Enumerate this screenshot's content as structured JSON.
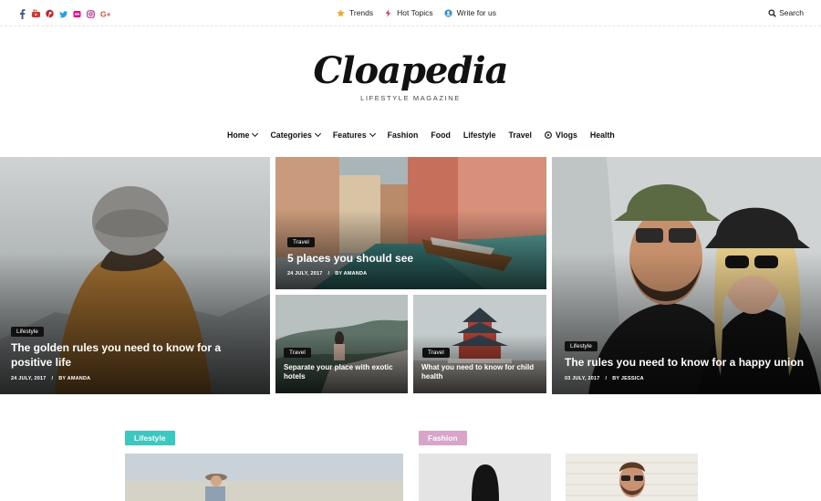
{
  "topbar": {
    "social": [
      {
        "icon": "facebook-icon",
        "color": "#3b5998"
      },
      {
        "icon": "youtube-icon",
        "color": "#e52d27"
      },
      {
        "icon": "pinterest-icon",
        "color": "#cb2027"
      },
      {
        "icon": "twitter-icon",
        "color": "#1da1f2"
      },
      {
        "icon": "flickr-icon",
        "color": "#ff0084"
      },
      {
        "icon": "instagram-icon",
        "color": "#bc2a8d"
      },
      {
        "icon": "google-plus-icon",
        "color": "#dd4b39"
      }
    ],
    "links": [
      {
        "label": "Trends",
        "icon": "star-icon",
        "color": "#f5a623"
      },
      {
        "label": "Hot Topics",
        "icon": "bolt-icon",
        "color": "#e8334a"
      },
      {
        "label": "Write for us",
        "icon": "user-circle-icon",
        "color": "#2b8cd8"
      }
    ],
    "search_label": "Search"
  },
  "logo": {
    "title": "Cloapedia",
    "subtitle": "LIFESTYLE MAGAZINE"
  },
  "nav": {
    "items": [
      {
        "label": "Home",
        "dropdown": true
      },
      {
        "label": "Categories",
        "dropdown": true
      },
      {
        "label": "Features",
        "dropdown": true
      },
      {
        "label": "Fashion",
        "dropdown": false
      },
      {
        "label": "Food",
        "dropdown": false
      },
      {
        "label": "Lifestyle",
        "dropdown": false
      },
      {
        "label": "Travel",
        "dropdown": false
      },
      {
        "label": "Vlogs",
        "dropdown": false,
        "icon": "play-circle-icon"
      },
      {
        "label": "Health",
        "dropdown": false
      }
    ]
  },
  "featured": {
    "left": {
      "category": "Lifestyle",
      "title": "The golden rules you need to know for a positive life",
      "date": "24 JULY, 2017",
      "author": "BY AMANDA"
    },
    "center_top": {
      "category": "Travel",
      "title": "5 places you should see",
      "date": "24 JULY, 2017",
      "author": "BY AMANDA"
    },
    "center_bottom_left": {
      "category": "Travel",
      "title": "Separate your place with exotic hotels"
    },
    "center_bottom_right": {
      "category": "Travel",
      "title": "What you need to know for child health"
    },
    "right": {
      "category": "Lifestyle",
      "title": "The rules you need to know for a happy union",
      "date": "03 JULY, 2017",
      "author": "BY JESSICA"
    }
  },
  "sections": [
    {
      "label": "Lifestyle",
      "color": "#3ac8c0"
    },
    {
      "label": "Fashion",
      "color": "#d9a4c9"
    }
  ]
}
